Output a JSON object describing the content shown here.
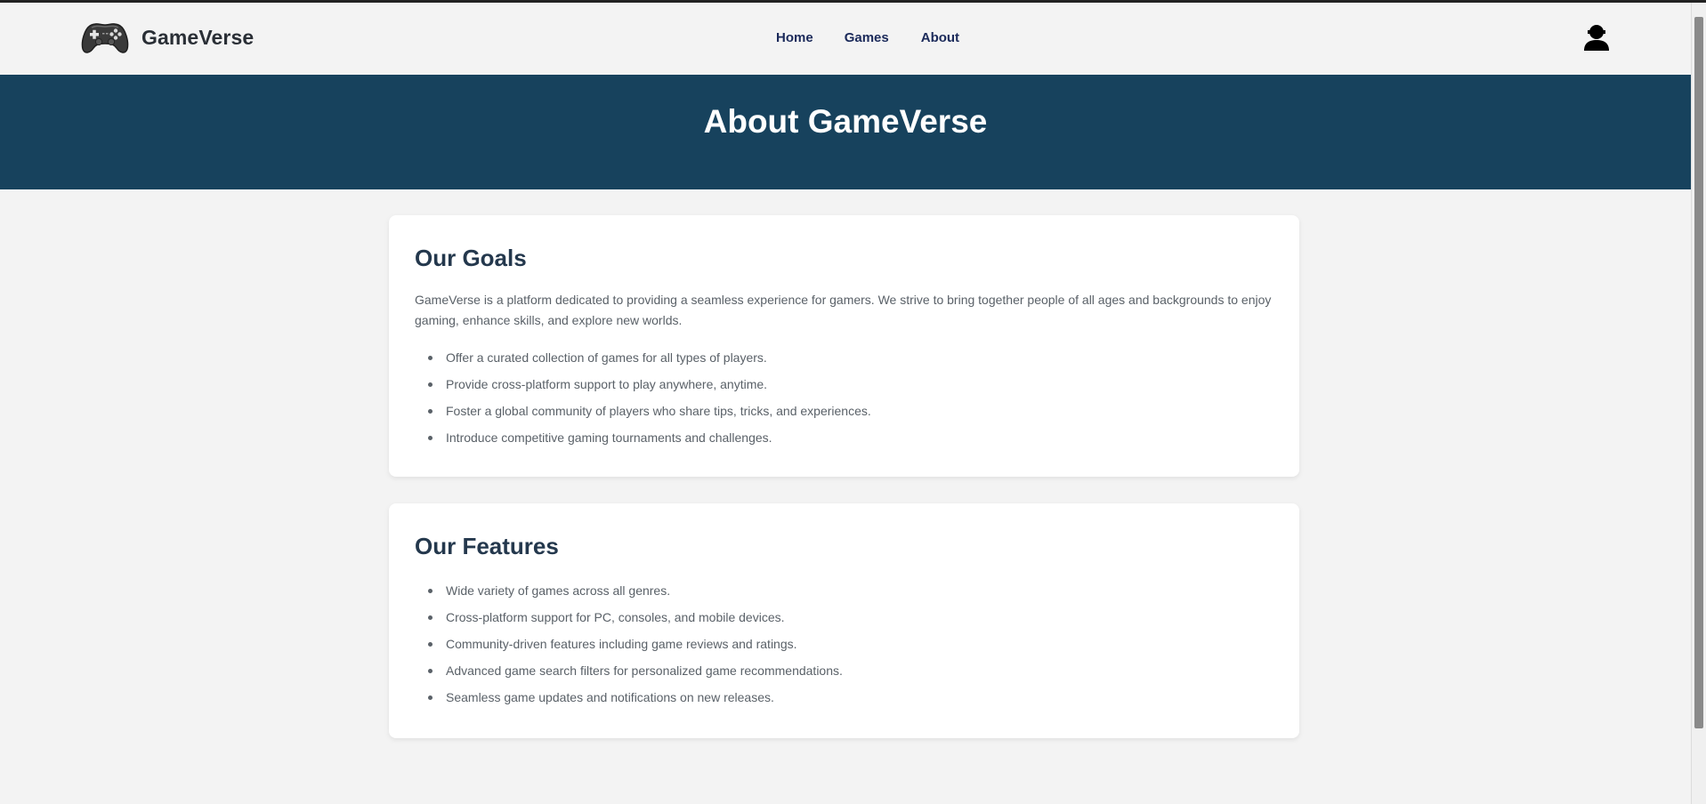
{
  "navbar": {
    "brand_name": "GameVerse",
    "logo_icon": "gamepad-icon",
    "links": [
      {
        "label": "Home"
      },
      {
        "label": "Games"
      },
      {
        "label": "About"
      }
    ],
    "user_icon": "user-icon"
  },
  "hero": {
    "title": "About GameVerse"
  },
  "goals": {
    "title": "Our Goals",
    "description": "GameVerse is a platform dedicated to providing a seamless experience for gamers. We strive to bring together people of all ages and backgrounds to enjoy gaming, enhance skills, and explore new worlds.",
    "items": [
      "Offer a curated collection of games for all types of players.",
      "Provide cross-platform support to play anywhere, anytime.",
      "Foster a global community of players who share tips, tricks, and experiences.",
      "Introduce competitive gaming tournaments and challenges."
    ]
  },
  "features": {
    "title": "Our Features",
    "items": [
      "Wide variety of games across all genres.",
      "Cross-platform support for PC, consoles, and mobile devices.",
      "Community-driven features including game reviews and ratings.",
      "Advanced game search filters for personalized game recommendations.",
      "Seamless game updates and notifications on new releases."
    ]
  },
  "colors": {
    "hero_background": "#17425d",
    "nav_link": "#1b2a5a",
    "heading": "#24384d",
    "body_text": "#5a6168",
    "page_background": "#f3f3f3"
  }
}
